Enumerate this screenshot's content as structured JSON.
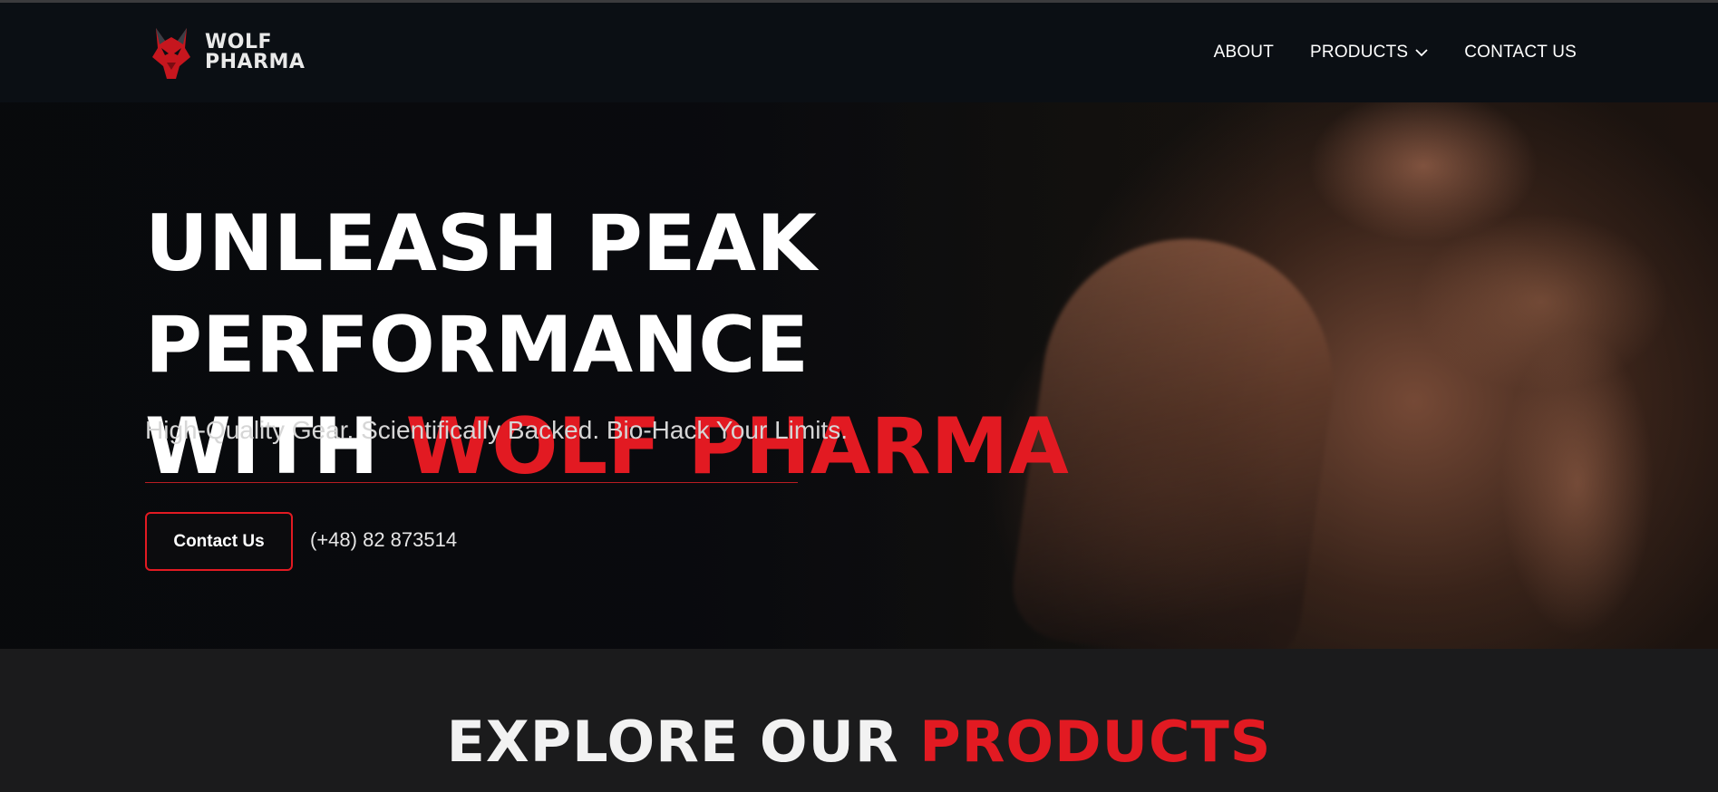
{
  "brand": {
    "line1": "WOLF",
    "line2": "PHARMA",
    "accent_color": "#e21a22",
    "icon": "wolf-head-logo"
  },
  "nav": {
    "about": "ABOUT",
    "products": "PRODUCTS",
    "contact": "CONTACT US",
    "products_icon": "chevron-down-icon"
  },
  "hero": {
    "headline_line1": "UNLEASH PEAK PERFORMANCE",
    "headline_line2_prefix": "WITH",
    "headline_line2_accent": "WOLF PHARMA",
    "subheadline": "High-Quality Gear. Scientifically Backed. Bio-Hack Your Limits.",
    "cta_label": "Contact Us",
    "phone": "(+48) 82 873514"
  },
  "products_section": {
    "title_prefix": "EXPLORE OUR",
    "title_accent": "PRODUCTS"
  }
}
